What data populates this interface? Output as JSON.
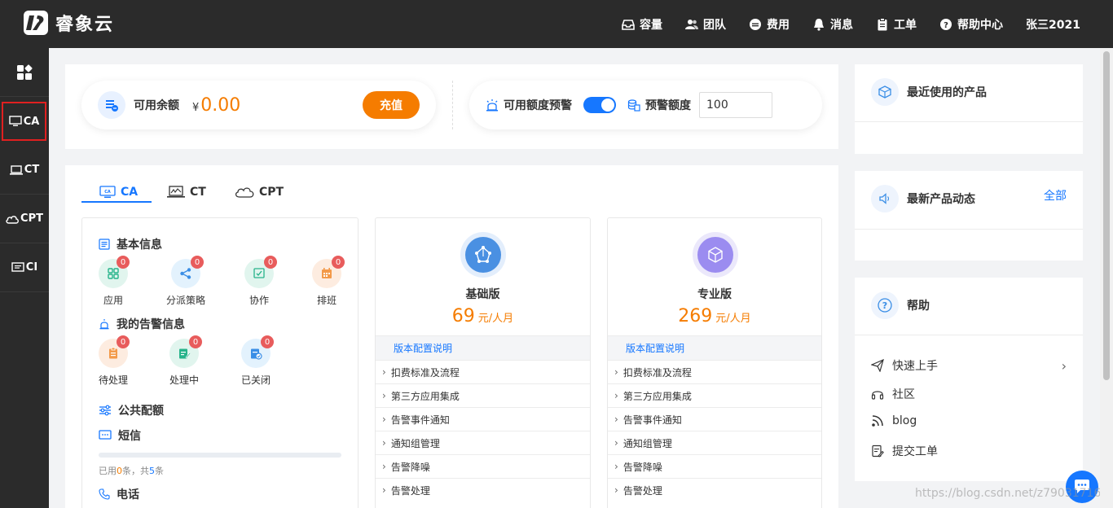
{
  "app": {
    "brand": "睿象云"
  },
  "nav": {
    "items": [
      {
        "label": "容量",
        "icon": "inbox-icon"
      },
      {
        "label": "团队",
        "icon": "team-icon"
      },
      {
        "label": "费用",
        "icon": "coin-icon"
      },
      {
        "label": "消息",
        "icon": "bell-icon"
      },
      {
        "label": "工单",
        "icon": "clipboard-icon"
      },
      {
        "label": "帮助中心",
        "icon": "help-icon"
      }
    ],
    "user": "张三2021"
  },
  "sidebar": {
    "items": [
      {
        "label": "",
        "icon": "apps-icon"
      },
      {
        "label": "CA",
        "icon": "monitor-icon",
        "active": true
      },
      {
        "label": "CT",
        "icon": "laptop-icon"
      },
      {
        "label": "CPT",
        "icon": "cloud-icon"
      },
      {
        "label": "CI",
        "icon": "screen-icon"
      }
    ]
  },
  "balance": {
    "label": "可用余额",
    "currency": "¥",
    "amount": "0.00",
    "recharge_label": "充值"
  },
  "alert": {
    "label": "可用额度预警",
    "enabled": true,
    "threshold_label": "预警额度",
    "threshold_value": "100"
  },
  "tabs": [
    {
      "label": "CA",
      "active": true
    },
    {
      "label": "CT",
      "active": false
    },
    {
      "label": "CPT",
      "active": false
    }
  ],
  "basic_info": {
    "title": "基本信息",
    "tiles": [
      {
        "label": "应用",
        "count": "0"
      },
      {
        "label": "分派策略",
        "count": "0"
      },
      {
        "label": "协作",
        "count": "0"
      },
      {
        "label": "排班",
        "count": "0"
      }
    ]
  },
  "my_alerts": {
    "title": "我的告警信息",
    "tiles": [
      {
        "label": "待处理",
        "count": "0"
      },
      {
        "label": "处理中",
        "count": "0"
      },
      {
        "label": "已关闭",
        "count": "0"
      }
    ]
  },
  "quota": {
    "title": "公共配额",
    "sms_title": "短信",
    "sms_used_prefix": "已用",
    "sms_used": "0",
    "sms_used_mid": "条，共",
    "sms_total": "5",
    "sms_used_suffix": "条",
    "sms_progress": 0,
    "phone_title": "电话"
  },
  "plans": [
    {
      "name": "基础版",
      "price": "69",
      "unit": "元/人月",
      "config_label": "版本配置说明",
      "features": [
        "扣费标准及流程",
        "第三方应用集成",
        "告警事件通知",
        "通知组管理",
        "告警降噪",
        "告警处理"
      ]
    },
    {
      "name": "专业版",
      "price": "269",
      "unit": "元/人月",
      "config_label": "版本配置说明",
      "features": [
        "扣费标准及流程",
        "第三方应用集成",
        "告警事件通知",
        "通知组管理",
        "告警降噪",
        "告警处理"
      ]
    }
  ],
  "right": {
    "recent_title": "最近使用的产品",
    "news_title": "最新产品动态",
    "news_all": "全部",
    "help_title": "帮助",
    "help_items": [
      "快速上手",
      "社区",
      "blog",
      "提交工单"
    ]
  },
  "watermark": "https://blog.csdn.net/z790317160",
  "colors": {
    "accent": "#1677ff",
    "orange": "#f57c00",
    "dark": "#2b2b2b",
    "badge": "#e85c5c"
  }
}
